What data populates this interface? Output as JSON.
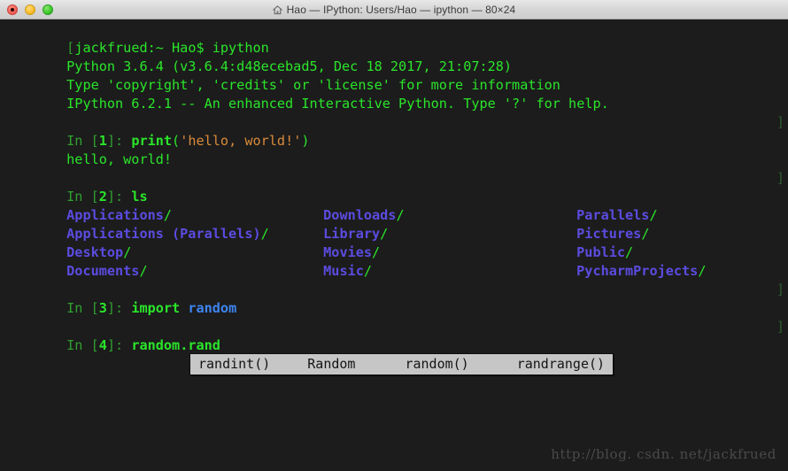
{
  "window": {
    "traffic_lights": [
      {
        "name": "close",
        "color": "#f3635a"
      },
      {
        "name": "minimize",
        "color": "#fcbd2c"
      },
      {
        "name": "maximize",
        "color": "#3cc72c"
      }
    ],
    "title": "Hao — IPython: Users/Hao — ipython — 80×24",
    "title_icon": "home-icon"
  },
  "terminal": {
    "background": "#1c1c1c",
    "foreground": "#2ae52a",
    "banner": [
      "jackfrued:~ Hao$ ipython",
      "Python 3.6.4 (v3.6.4:d48ecebad5, Dec 18 2017, 21:07:28)",
      "Type 'copyright', 'credits' or 'license' for more information",
      "IPython 6.2.1 -- An enhanced Interactive Python. Type '?' for help."
    ],
    "prompts": {
      "in_open": "In [",
      "in_close": "]: ",
      "edge_bracket": "]"
    },
    "cells": [
      {
        "number": "1",
        "code_parts": [
          {
            "text": "print",
            "style": "function"
          },
          {
            "text": "(",
            "style": "punct"
          },
          {
            "text": "'hello, world!'",
            "style": "string"
          },
          {
            "text": ")",
            "style": "punct"
          }
        ],
        "output": [
          "hello, world!"
        ]
      },
      {
        "number": "2",
        "code_parts": [
          {
            "text": "ls",
            "style": "keyword"
          }
        ],
        "listing": [
          [
            "Applications",
            "Downloads",
            "Parallels"
          ],
          [
            "Applications (Parallels)",
            "Library",
            "Pictures"
          ],
          [
            "Desktop",
            "Movies",
            "Public"
          ],
          [
            "Documents",
            "Music",
            "PycharmProjects"
          ]
        ],
        "listing_suffix": "/"
      },
      {
        "number": "3",
        "code_parts": [
          {
            "text": "import",
            "style": "keyword"
          },
          {
            "text": " ",
            "style": "punct"
          },
          {
            "text": "random",
            "style": "module"
          }
        ]
      },
      {
        "number": "4",
        "code_parts": [
          {
            "text": "random.rand",
            "style": "plain"
          }
        ]
      }
    ]
  },
  "completion_popup": {
    "items": [
      "randint()",
      "Random",
      "random()",
      "randrange()"
    ],
    "background": "#c6c6c6",
    "text_color": "#141414"
  },
  "watermark": {
    "text": "http://blog. csdn. net/jackfrued"
  }
}
